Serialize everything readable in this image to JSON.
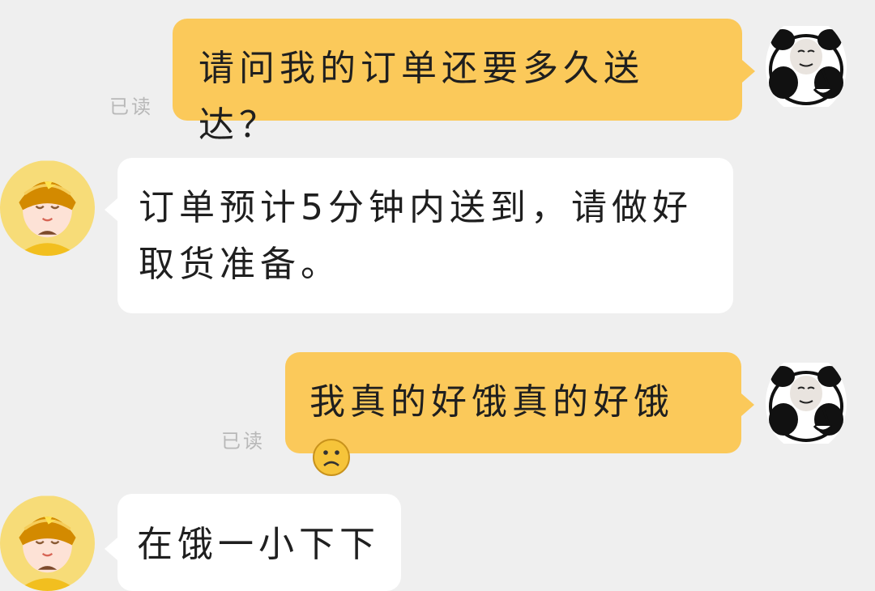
{
  "messages": [
    {
      "role": "user",
      "text": "请问我的订单还要多久送达？",
      "status": "已读"
    },
    {
      "role": "courier",
      "text": "订单预计5分钟内送到，请做好取货准备。"
    },
    {
      "role": "user",
      "text": "我真的好饿真的好饿",
      "emoji": "frowning-face-emoji",
      "status": "已读"
    },
    {
      "role": "courier",
      "text": "在饿一小下下"
    }
  ],
  "avatars": {
    "user": "panda-meme-avatar",
    "courier": "delivery-rider-avatar"
  },
  "colors": {
    "background": "#efefef",
    "outgoing_bubble": "#fbc95a",
    "incoming_bubble": "#ffffff",
    "read_label": "#b8b8b8",
    "courier_helmet": "#d38a00"
  }
}
